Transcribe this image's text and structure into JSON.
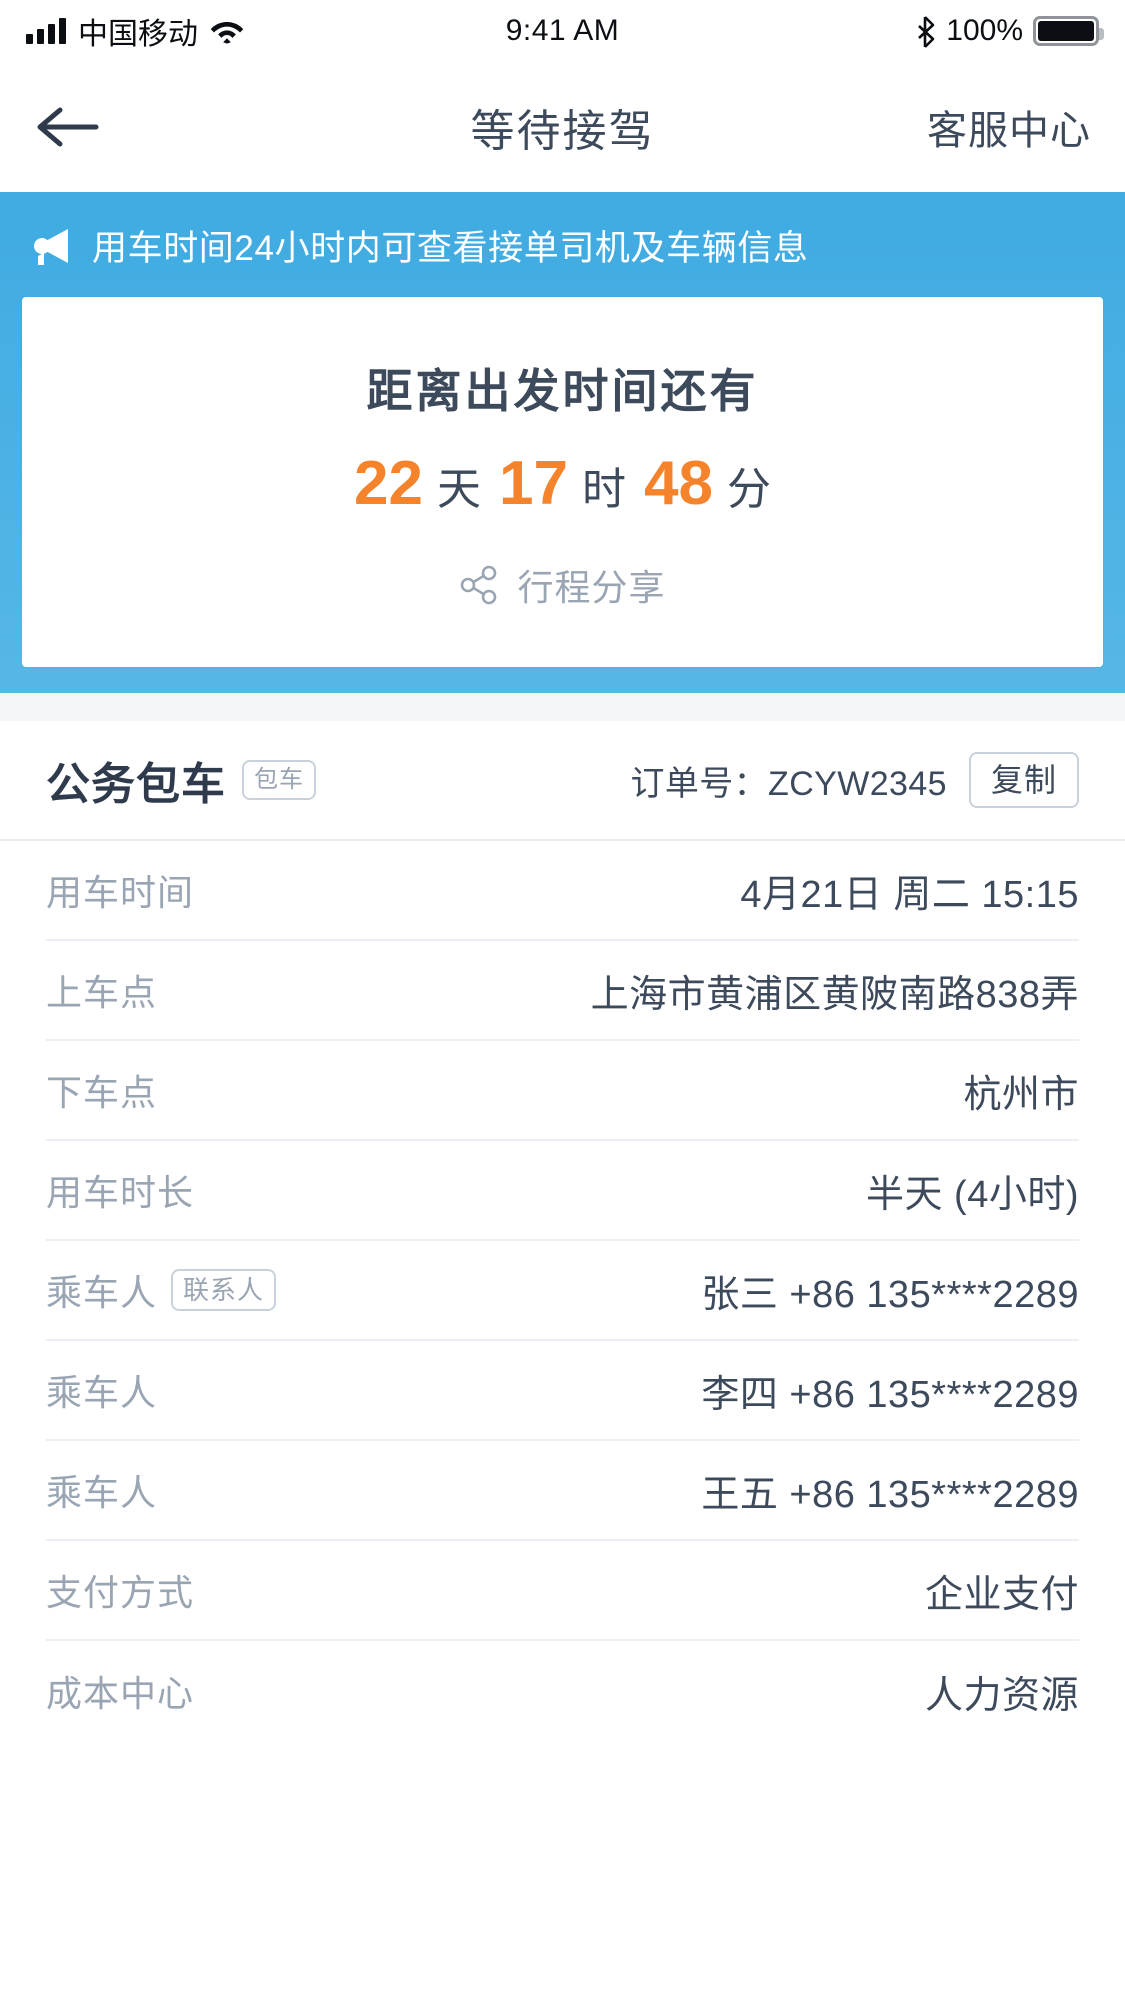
{
  "status_bar": {
    "carrier": "中国移动",
    "time": "9:41 AM",
    "battery_percent": "100%",
    "signal_icon": "signal-bars-icon",
    "wifi_icon": "wifi-icon",
    "bluetooth_icon": "bluetooth-icon",
    "battery_icon": "battery-full-icon"
  },
  "nav_bar": {
    "back_icon": "back-arrow-icon",
    "title": "等待接驾",
    "action_label": "客服中心"
  },
  "notice": {
    "icon": "megaphone-icon",
    "text": "用车时间24小时内可查看接单司机及车辆信息",
    "background_color": "#45AEE3"
  },
  "countdown": {
    "title": "距离出发时间还有",
    "days": "22",
    "days_unit": "天",
    "hours": "17",
    "hours_unit": "时",
    "minutes": "48",
    "minutes_unit": "分",
    "number_color": "#F5832B",
    "unit_color": "#3D4A5C",
    "share": {
      "icon": "share-nodes-icon",
      "label": "行程分享"
    }
  },
  "order": {
    "type": "公务包车",
    "type_tag": "包车",
    "order_no_label": "订单号：",
    "order_no": "ZCYW2345",
    "copy_label": "复制"
  },
  "details": [
    {
      "label": "用车时间",
      "tag": "",
      "value": "4月21日 周二 15:15"
    },
    {
      "label": "上车点",
      "tag": "",
      "value": "上海市黄浦区黄陂南路838弄"
    },
    {
      "label": "下车点",
      "tag": "",
      "value": "杭州市"
    },
    {
      "label": "用车时长",
      "tag": "",
      "value": "半天 (4小时)"
    },
    {
      "label": "乘车人",
      "tag": "联系人",
      "value": "张三 +86 135****2289"
    },
    {
      "label": "乘车人",
      "tag": "",
      "value": "李四 +86 135****2289"
    },
    {
      "label": "乘车人",
      "tag": "",
      "value": "王五 +86 135****2289"
    },
    {
      "label": "支付方式",
      "tag": "",
      "value": "企业支付"
    },
    {
      "label": "成本中心",
      "tag": "",
      "value": "人力资源"
    }
  ]
}
